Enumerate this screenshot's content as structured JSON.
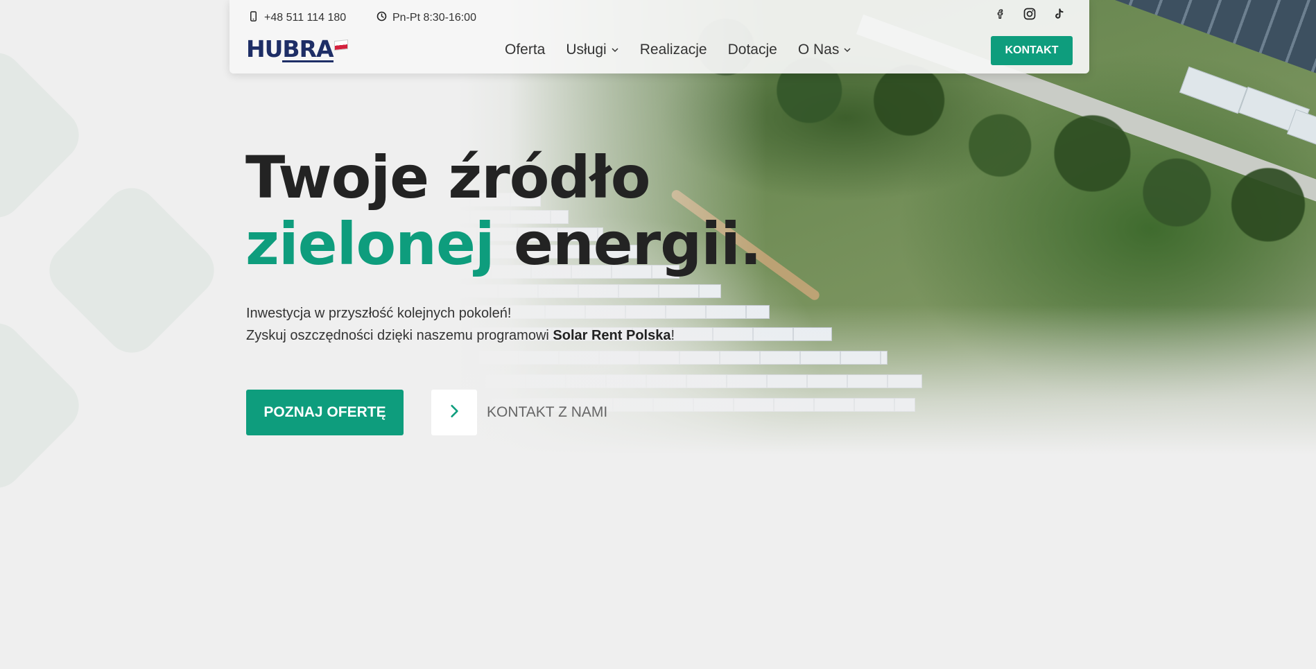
{
  "topbar": {
    "phone": "+48 511 114 180",
    "hours": "Pn-Pt 8:30-16:00",
    "social": [
      {
        "icon": "facebook-icon"
      },
      {
        "icon": "instagram-icon"
      },
      {
        "icon": "tiktok-icon"
      }
    ]
  },
  "logo": {
    "part1": "HU",
    "part2": "BRA"
  },
  "nav": {
    "items": [
      {
        "label": "Oferta",
        "dropdown": false
      },
      {
        "label": "Usługi",
        "dropdown": true
      },
      {
        "label": "Realizacje",
        "dropdown": false
      },
      {
        "label": "Dotacje",
        "dropdown": false
      },
      {
        "label": "O Nas",
        "dropdown": true
      }
    ],
    "cta": "KONTAKT"
  },
  "hero": {
    "headline_line1": "Twoje źródło",
    "headline_green": "zielonej",
    "headline_rest": " energii.",
    "sub_line1": "Inwestycja w przyszłość kolejnych pokoleń!",
    "sub_line2_pre": "Zyskuj oszczędności dzięki naszemu programowi ",
    "sub_line2_bold": "Solar Rent Polska",
    "sub_line2_post": "!",
    "primary_button": "POZNAJ OFERTĘ",
    "secondary_button": "KONTAKT Z NAMI"
  },
  "colors": {
    "accent": "#0e9d7d",
    "brand": "#1e2e66",
    "text": "#232323"
  }
}
